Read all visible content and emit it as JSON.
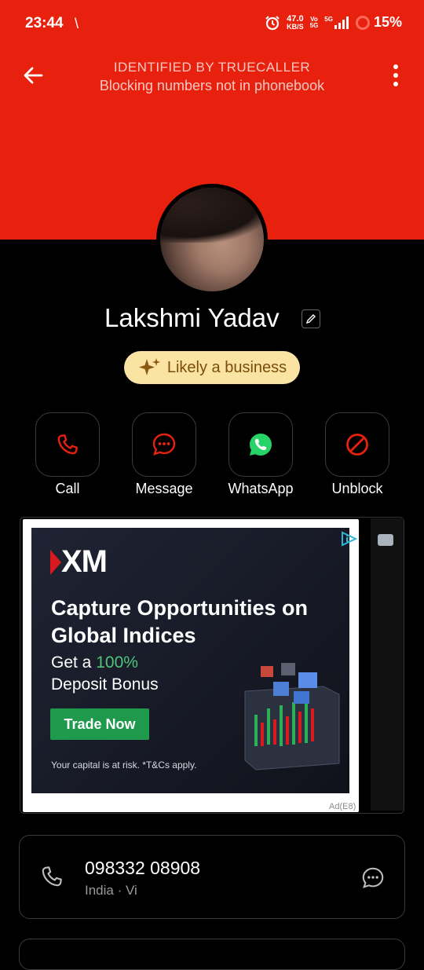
{
  "status_bar": {
    "time": "23:44",
    "extra": "\\",
    "net_speed": "47.0",
    "net_unit": "KB/S",
    "volte_top": "Vo",
    "volte_bottom": "5G",
    "signal_label": "5G",
    "battery": "15%"
  },
  "header": {
    "title": "IDENTIFIED BY TRUECALLER",
    "subtitle": "Blocking numbers not in phonebook",
    "accent_color": "#e8210f"
  },
  "contact": {
    "name": "Lakshmi Yadav",
    "badge": "Likely a business"
  },
  "actions": [
    {
      "label": "Call",
      "icon": "phone-icon",
      "color": "#e8210f"
    },
    {
      "label": "Message",
      "icon": "message-icon",
      "color": "#e8210f"
    },
    {
      "label": "WhatsApp",
      "icon": "whatsapp-icon",
      "color": "#25d366"
    },
    {
      "label": "Unblock",
      "icon": "block-icon",
      "color": "#e8210f"
    }
  ],
  "ad": {
    "brand": "XM",
    "headline": "Capture Opportunities on Global Indices",
    "sub_prefix": "Get a",
    "sub_highlight": "100%",
    "sub_suffix": "Deposit Bonus",
    "cta": "Trade Now",
    "disclaimer": "Your capital is at risk. *T&Cs apply.",
    "ad_id": "Ad(E8)"
  },
  "number_card": {
    "number": "098332 08908",
    "location": "India · Vi"
  }
}
